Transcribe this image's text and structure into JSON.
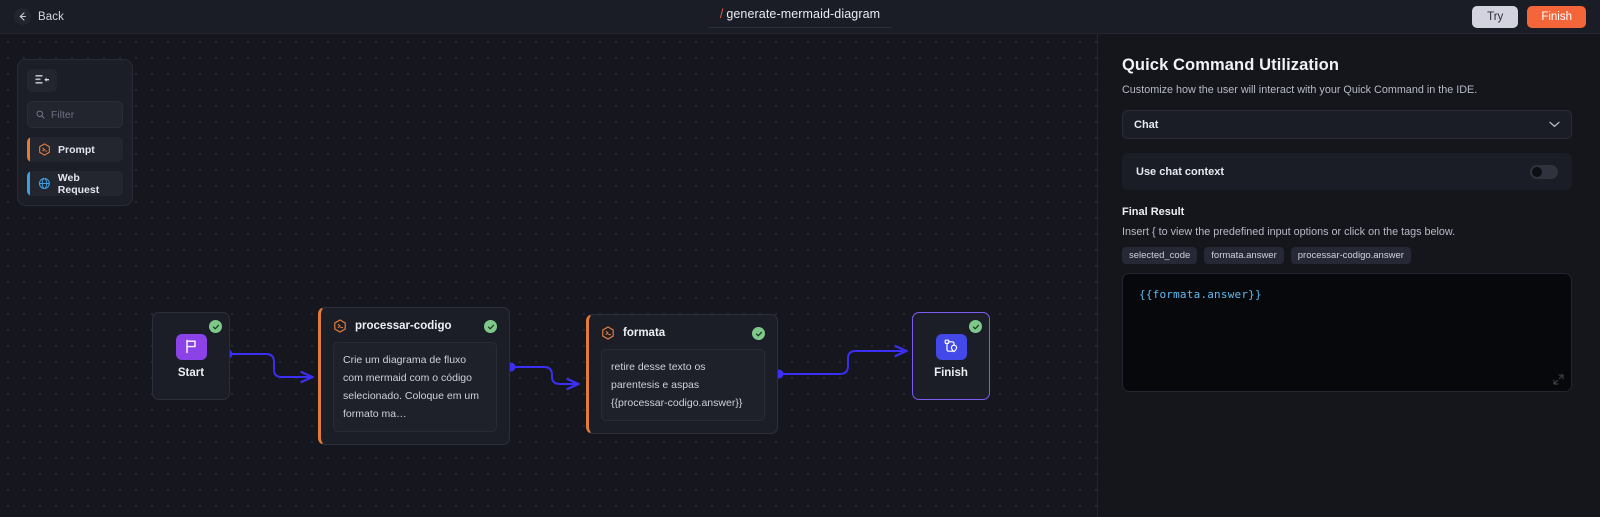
{
  "topbar": {
    "back_label": "Back",
    "title_prefix": "/",
    "title": "generate-mermaid-diagram",
    "try_label": "Try",
    "finish_label": "Finish",
    "accent_orange": "#f4663a",
    "try_bg": "#d2d3de"
  },
  "library": {
    "search_placeholder": "Filter",
    "search_value": "",
    "items": [
      {
        "label": "Prompt",
        "accent": "#e07b3c"
      },
      {
        "label": "Web Request",
        "accent": "#3d9fe0"
      }
    ]
  },
  "flow": {
    "nodes": [
      {
        "id": "start",
        "label": "Start",
        "status": "ok"
      },
      {
        "id": "processar-codigo",
        "label": "processar-codigo",
        "body": "Crie um diagrama de fluxo com mermaid com o código selecionado. Coloque em um formato ma…",
        "status": "ok"
      },
      {
        "id": "formata",
        "label": "formata",
        "body": "retire desse texto os parentesis e aspas {{processar-codigo.answer}}",
        "status": "ok"
      },
      {
        "id": "finish",
        "label": "Finish",
        "status": "ok",
        "selected": true
      }
    ],
    "edge_color": "#3b2ff5"
  },
  "sidebar": {
    "title": "Quick Command Utilization",
    "subtitle": "Customize how the user will interact with your Quick Command in the IDE.",
    "mode_value": "Chat",
    "toggle_label": "Use chat context",
    "toggle_on": false,
    "section_title": "Final Result",
    "hint": "Insert { to view the predefined input options or click on the tags below.",
    "tags": [
      "selected_code",
      "formata.answer",
      "processar-codigo.answer"
    ],
    "code": "{{formata.answer}}"
  }
}
